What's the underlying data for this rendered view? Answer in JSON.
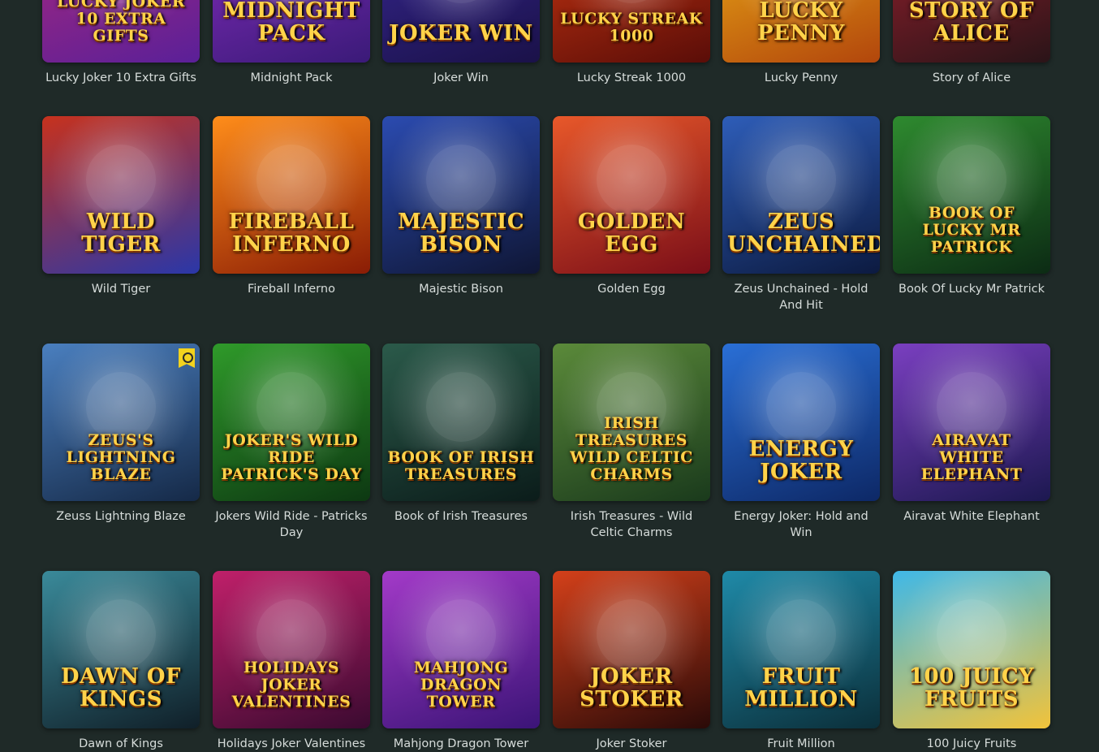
{
  "games": [
    {
      "name": "Lucky Joker 10 Extra Gifts",
      "logo": "Lucky Joker 10 Extra Gifts",
      "bg": [
        "#b1287a",
        "#5a2098"
      ]
    },
    {
      "name": "Midnight Pack",
      "logo": "Midnight Pack",
      "bg": [
        "#8b2ec2",
        "#3a1a78"
      ]
    },
    {
      "name": "Joker Win",
      "logo": "Joker Win",
      "bg": [
        "#3a2a9a",
        "#1a1148"
      ]
    },
    {
      "name": "Lucky Streak 1000",
      "logo": "Lucky Streak 1000",
      "bg": [
        "#d43a12",
        "#5a0d08"
      ]
    },
    {
      "name": "Lucky Penny",
      "logo": "Lucky Penny",
      "bg": [
        "#f0b517",
        "#b2460c"
      ]
    },
    {
      "name": "Story of Alice",
      "logo": "Story of Alice",
      "bg": [
        "#a1212f",
        "#2a1418"
      ]
    },
    {
      "name": "Wild Tiger",
      "logo": "Wild Tiger",
      "bg": [
        "#c7321d",
        "#2a37a8"
      ]
    },
    {
      "name": "Fireball Inferno",
      "logo": "Fireball Inferno",
      "bg": [
        "#ff8d1a",
        "#8a1c05"
      ]
    },
    {
      "name": "Majestic Bison",
      "logo": "Majestic Bison",
      "bg": [
        "#2b4bb0",
        "#0f1635"
      ]
    },
    {
      "name": "Golden Egg",
      "logo": "Golden Egg",
      "bg": [
        "#e8582a",
        "#7a0e18"
      ]
    },
    {
      "name": "Zeus Unchained - Hold And Hit",
      "logo": "Zeus Unchained",
      "bg": [
        "#2e5db8",
        "#0c1a40"
      ]
    },
    {
      "name": "Book Of Lucky Mr Patrick",
      "logo": "Book of Lucky Mr Patrick",
      "bg": [
        "#2e8a2f",
        "#0c2b14"
      ]
    },
    {
      "name": "Zeuss Lightning Blaze",
      "logo": "Zeus's Lightning Blaze",
      "bg": [
        "#4a7fbf",
        "#152947"
      ],
      "badge": true
    },
    {
      "name": "Jokers Wild Ride - Patricks Day",
      "logo": "Joker's Wild Ride Patrick's Day",
      "bg": [
        "#2f9a2a",
        "#0d3812"
      ]
    },
    {
      "name": "Book of Irish Treasures",
      "logo": "Book of Irish Treasures",
      "bg": [
        "#2b5a4a",
        "#0b1c1a"
      ]
    },
    {
      "name": "Irish Treasures - Wild Celtic Charms",
      "logo": "Irish Treasures Wild Celtic Charms",
      "bg": [
        "#5b8a3a",
        "#1a3a1c"
      ]
    },
    {
      "name": "Energy Joker: Hold and Win",
      "logo": "Energy Joker",
      "bg": [
        "#2a6fd6",
        "#0d2866"
      ]
    },
    {
      "name": "Airavat White Elephant",
      "logo": "Airavat White Elephant",
      "bg": [
        "#7a3fc0",
        "#1c1850"
      ]
    },
    {
      "name": "Dawn of Kings",
      "logo": "Dawn of Kings",
      "bg": [
        "#3a8a9a",
        "#101f28"
      ]
    },
    {
      "name": "Holidays Joker Valentines",
      "logo": "Holidays Joker Valentines",
      "bg": [
        "#c0206a",
        "#3a0a30"
      ]
    },
    {
      "name": "Mahjong Dragon Tower",
      "logo": "Mahjong Dragon Tower",
      "bg": [
        "#a33ac8",
        "#3b1477"
      ]
    },
    {
      "name": "Joker Stoker",
      "logo": "Joker Stoker",
      "bg": [
        "#d4401a",
        "#2a0a08"
      ]
    },
    {
      "name": "Fruit Million",
      "logo": "Fruit Million",
      "bg": [
        "#1f8aa8",
        "#0b2f3a"
      ]
    },
    {
      "name": "100 Juicy Fruits",
      "logo": "100 Juicy Fruits",
      "bg": [
        "#3fb8e8",
        "#f2c33a"
      ]
    }
  ]
}
